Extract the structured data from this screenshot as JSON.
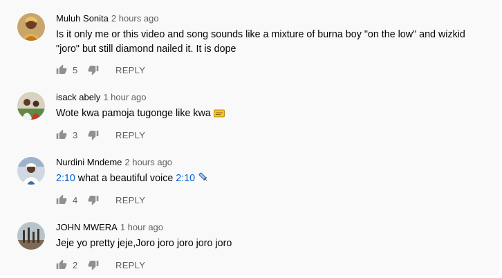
{
  "comments": [
    {
      "author": "Muluh Sonita",
      "time": "2 hours ago",
      "text_line1": "Is it only me or this video and song sounds like a mixture of burna boy \"on the low\" and wizkid",
      "text_line2": "\"joro\" but still diamond nailed it.  It is dope",
      "likes": "5",
      "reply_label": "REPLY"
    },
    {
      "author": "isack abely",
      "time": "1 hour ago",
      "text": "Wote kwa pamoja tugonge like kwa",
      "emoji_icon": "ticket-emoji-icon",
      "likes": "3",
      "reply_label": "REPLY"
    },
    {
      "author": "Nurdini Mndeme",
      "time": "2 hours ago",
      "timestamp1": "2:10",
      "text_middle": " what a beautiful voice ",
      "timestamp2": "2:10",
      "emoji_icon": "syringe-emoji-icon",
      "likes": "4",
      "reply_label": "REPLY"
    },
    {
      "author": "JOHN MWERA",
      "time": "1 hour ago",
      "text": "Jeje yo pretty jeje,Joro joro joro joro joro",
      "likes": "2",
      "reply_label": "REPLY"
    }
  ],
  "colors": {
    "background": "#f9f9f9",
    "text": "#030303",
    "secondary": "#606060",
    "link": "#065fd4"
  }
}
